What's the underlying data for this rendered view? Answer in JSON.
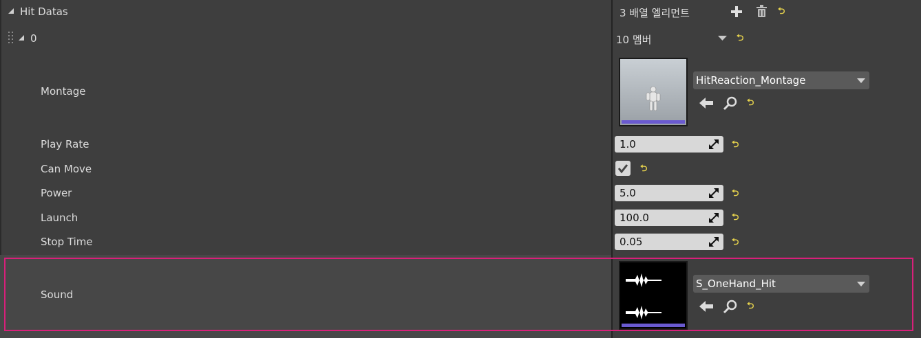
{
  "header": {
    "title": "Hit Datas",
    "array_count": "3 배열 엘리먼트"
  },
  "element": {
    "index": "0",
    "member_count": "10 멤버"
  },
  "properties": {
    "montage": {
      "label": "Montage",
      "asset": "HitReaction_Montage"
    },
    "play_rate": {
      "label": "Play Rate",
      "value": "1.0"
    },
    "can_move": {
      "label": "Can Move",
      "checked": true
    },
    "power": {
      "label": "Power",
      "value": "5.0"
    },
    "launch": {
      "label": "Launch",
      "value": "100.0"
    },
    "stop_time": {
      "label": "Stop Time",
      "value": "0.05"
    },
    "sound": {
      "label": "Sound",
      "asset": "S_OneHand_Hit"
    }
  },
  "colors": {
    "reset_arrow": "#e8d44d",
    "highlight": "#d8207a",
    "thumbnail_bar": "#6a5ad0"
  },
  "icons": [
    "collapse-triangle-icon",
    "add-icon",
    "trash-icon",
    "reset-arrow-icon",
    "browse-arrow-icon",
    "search-icon",
    "drag-handle-icon",
    "chevron-down-icon",
    "checkmark-icon"
  ]
}
